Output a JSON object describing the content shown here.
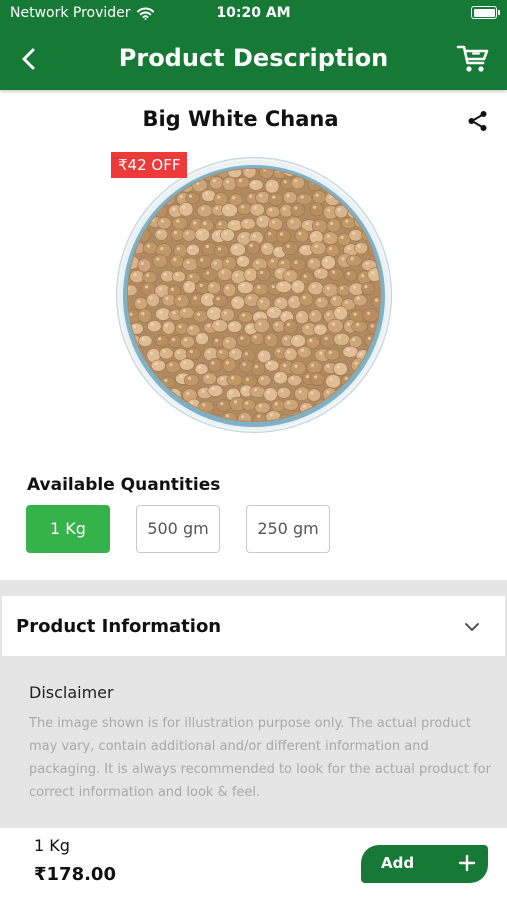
{
  "status_bar": {
    "carrier": "Network Provider",
    "time": "10:20 AM",
    "icons": [
      "wifi-icon",
      "battery-icon"
    ]
  },
  "nav": {
    "title": "Product Description",
    "icons": [
      "back-arrow-icon",
      "cart-icon"
    ]
  },
  "product": {
    "name": "Big White Chana",
    "discount_badge": "₹42 OFF",
    "image_alt": "Bowl of white chickpeas",
    "share_icon": "share-icon"
  },
  "quantities": {
    "heading": "Available Quantities",
    "options": [
      "1 Kg",
      "500 gm",
      "250 gm"
    ],
    "selected": "1 Kg"
  },
  "product_info": {
    "title": "Product Information",
    "toggle_icon": "chevron-down-icon",
    "disclaimer_title": "Disclaimer",
    "disclaimer_text": "The image shown is for illustration purpose only. The actual product may vary, contain additional and/or different information and packaging. It is always recommended to look for the actual product for correct information and look & feel."
  },
  "bottom_bar": {
    "quantity": "1 Kg",
    "price": "₹178.00",
    "add_label": "Add",
    "add_icon": "plus-icon"
  },
  "colors": {
    "primary_green": "#167a36",
    "selected_green": "#36b24a",
    "badge_red": "#ef3a3a",
    "section_gray": "#e5e5e5"
  }
}
